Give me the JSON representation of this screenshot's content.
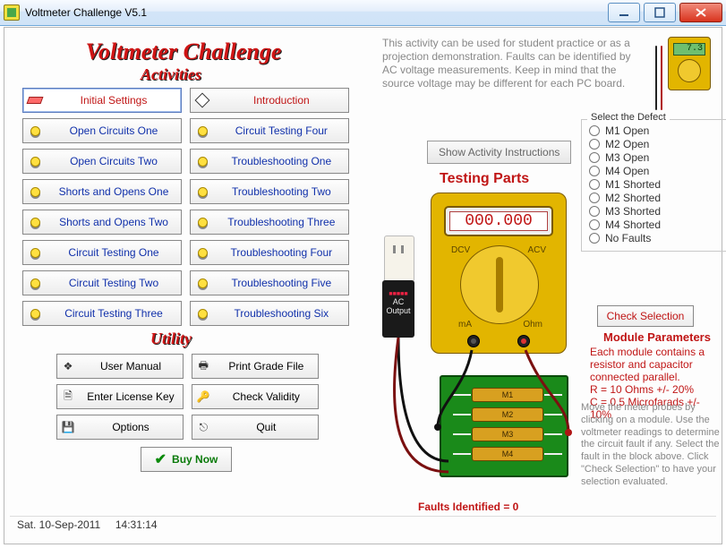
{
  "window": {
    "title": "Voltmeter Challenge V5.1"
  },
  "headings": {
    "main": "Voltmeter Challenge",
    "activities": "Activities",
    "utility": "Utility"
  },
  "activities_left": [
    {
      "id": "initial-settings",
      "label": "Initial Settings",
      "red": true,
      "icon": "eraser",
      "selected": true
    },
    {
      "id": "open-circuits-one",
      "label": "Open Circuits One"
    },
    {
      "id": "open-circuits-two",
      "label": "Open Circuits Two"
    },
    {
      "id": "shorts-and-opens-one",
      "label": "Shorts and Opens One"
    },
    {
      "id": "shorts-and-opens-two",
      "label": "Shorts and Opens Two"
    },
    {
      "id": "circuit-testing-one",
      "label": "Circuit Testing One"
    },
    {
      "id": "circuit-testing-two",
      "label": "Circuit Testing Two"
    },
    {
      "id": "circuit-testing-three",
      "label": "Circuit Testing Three"
    }
  ],
  "activities_right": [
    {
      "id": "introduction",
      "label": "Introduction",
      "red": true,
      "icon": "diamond"
    },
    {
      "id": "circuit-testing-four",
      "label": "Circuit Testing Four"
    },
    {
      "id": "troubleshooting-one",
      "label": "Troubleshooting One"
    },
    {
      "id": "troubleshooting-two",
      "label": "Troubleshooting Two"
    },
    {
      "id": "troubleshooting-three",
      "label": "Troubleshooting Three"
    },
    {
      "id": "troubleshooting-four",
      "label": "Troubleshooting Four"
    },
    {
      "id": "troubleshooting-five",
      "label": "Troubleshooting Five"
    },
    {
      "id": "troubleshooting-six",
      "label": "Troubleshooting Six"
    }
  ],
  "utility_left": [
    {
      "id": "user-manual",
      "label": "User Manual",
      "glyph": "❖"
    },
    {
      "id": "enter-license-key",
      "label": "Enter License Key",
      "glyph": "🗎"
    },
    {
      "id": "options",
      "label": "Options",
      "glyph": "💾"
    }
  ],
  "utility_right": [
    {
      "id": "print-grade-file",
      "label": "Print Grade File",
      "glyph": "🖶"
    },
    {
      "id": "check-validity",
      "label": "Check Validity",
      "glyph": "🔑"
    },
    {
      "id": "quit",
      "label": "Quit",
      "glyph": "⎋"
    }
  ],
  "buy_now": "Buy Now",
  "description": "This activity can be used for student practice or as a projection demonstration. Faults can be identified by AC voltage measurements. Keep in mind that the source voltage may be different for each PC board.",
  "show_activity": "Show Activity Instructions",
  "testing_parts": "Testing Parts",
  "meter": {
    "readout": "000.000",
    "mini_readout": "7.3",
    "labels": {
      "dcv": "DCV",
      "acv": "ACV",
      "ma": "mA",
      "ohm": "Ohm"
    },
    "ac_output_top": "AC",
    "ac_output_bot": "Output"
  },
  "defects": {
    "legend": "Select the Defect",
    "options": [
      "M1 Open",
      "M2 Open",
      "M3 Open",
      "M4 Open",
      "M1 Shorted",
      "M2 Shorted",
      "M3 Shorted",
      "M4 Shorted",
      "No Faults"
    ]
  },
  "check_selection": "Check Selection",
  "module_params": {
    "title": "Module Parameters",
    "line1": "Each module contains a resistor and capacitor connected parallel.",
    "line2": "R = 10 Ohms +/- 20%",
    "line3": "C = 0.5 Microfarads +/- 10%"
  },
  "instructions": "Move the meter probes by clicking on a module. Use the voltmeter readings to determine the circuit fault if any. Select the fault in the block above. Click \"Check Selection\" to have your selection evaluated.",
  "modules": [
    "M1",
    "M2",
    "M3",
    "M4"
  ],
  "faults_identified": "Faults Identified = 0",
  "status": {
    "date": "Sat.  10-Sep-2011",
    "time": "14:31:14"
  }
}
